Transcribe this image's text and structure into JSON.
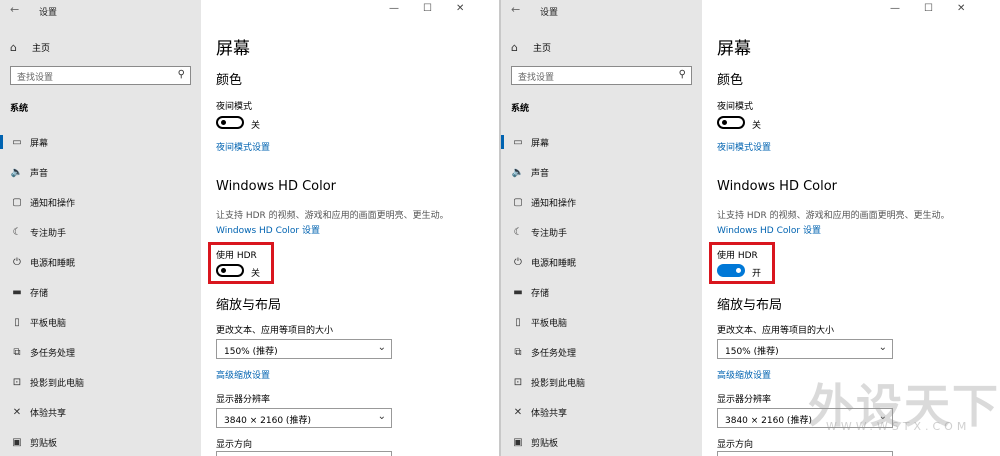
{
  "window": {
    "title": "设置",
    "back_glyph": "←",
    "controls": [
      "—",
      "☐",
      "✕"
    ]
  },
  "sidebar": {
    "home_label": "主页",
    "search_placeholder": "查找设置",
    "section_label": "系统",
    "items": [
      {
        "label": "屏幕",
        "icon": "monitor-icon",
        "glyph": "▭"
      },
      {
        "label": "声音",
        "icon": "speaker-icon",
        "glyph": "🔈"
      },
      {
        "label": "通知和操作",
        "icon": "notification-icon",
        "glyph": "▢"
      },
      {
        "label": "专注助手",
        "icon": "moon-icon",
        "glyph": "☾"
      },
      {
        "label": "电源和睡眠",
        "icon": "power-icon",
        "glyph": "⏻"
      },
      {
        "label": "存储",
        "icon": "storage-icon",
        "glyph": "▬"
      },
      {
        "label": "平板电脑",
        "icon": "tablet-icon",
        "glyph": "▯"
      },
      {
        "label": "多任务处理",
        "icon": "multitask-icon",
        "glyph": "⧉"
      },
      {
        "label": "投影到此电脑",
        "icon": "project-icon",
        "glyph": "⊡"
      },
      {
        "label": "体验共享",
        "icon": "shared-experience-icon",
        "glyph": "✕"
      },
      {
        "label": "剪贴板",
        "icon": "clipboard-icon",
        "glyph": "▣"
      }
    ]
  },
  "main": {
    "page_title": "屏幕",
    "color_heading": "颜色",
    "night_light_label": "夜间模式",
    "night_light_state": "关",
    "night_light_link": "夜间模式设置",
    "hdr_heading": "Windows HD Color",
    "hdr_desc": "让支持 HDR 的视频、游戏和应用的画面更明亮、更生动。",
    "hdr_link": "Windows HD Color 设置",
    "hdr_toggle_label": "使用 HDR",
    "scale_heading": "缩放与布局",
    "scale_label": "更改文本、应用等项目的大小",
    "scale_value": "150% (推荐)",
    "scale_link": "高级缩放设置",
    "resolution_label": "显示器分辨率",
    "resolution_value": "3840 × 2160 (推荐)",
    "orientation_label": "显示方向"
  },
  "panels": {
    "left": {
      "hdr_on": false,
      "hdr_state": "关"
    },
    "right": {
      "hdr_on": true,
      "hdr_state": "开"
    }
  },
  "colors": {
    "accent": "#0078d7",
    "link": "#0063b1",
    "highlight": "#d9161e",
    "sidebar_bg": "#e6e6e6"
  },
  "watermark": {
    "text": "外设天下",
    "sub": "WWW.WSTX.COM"
  }
}
